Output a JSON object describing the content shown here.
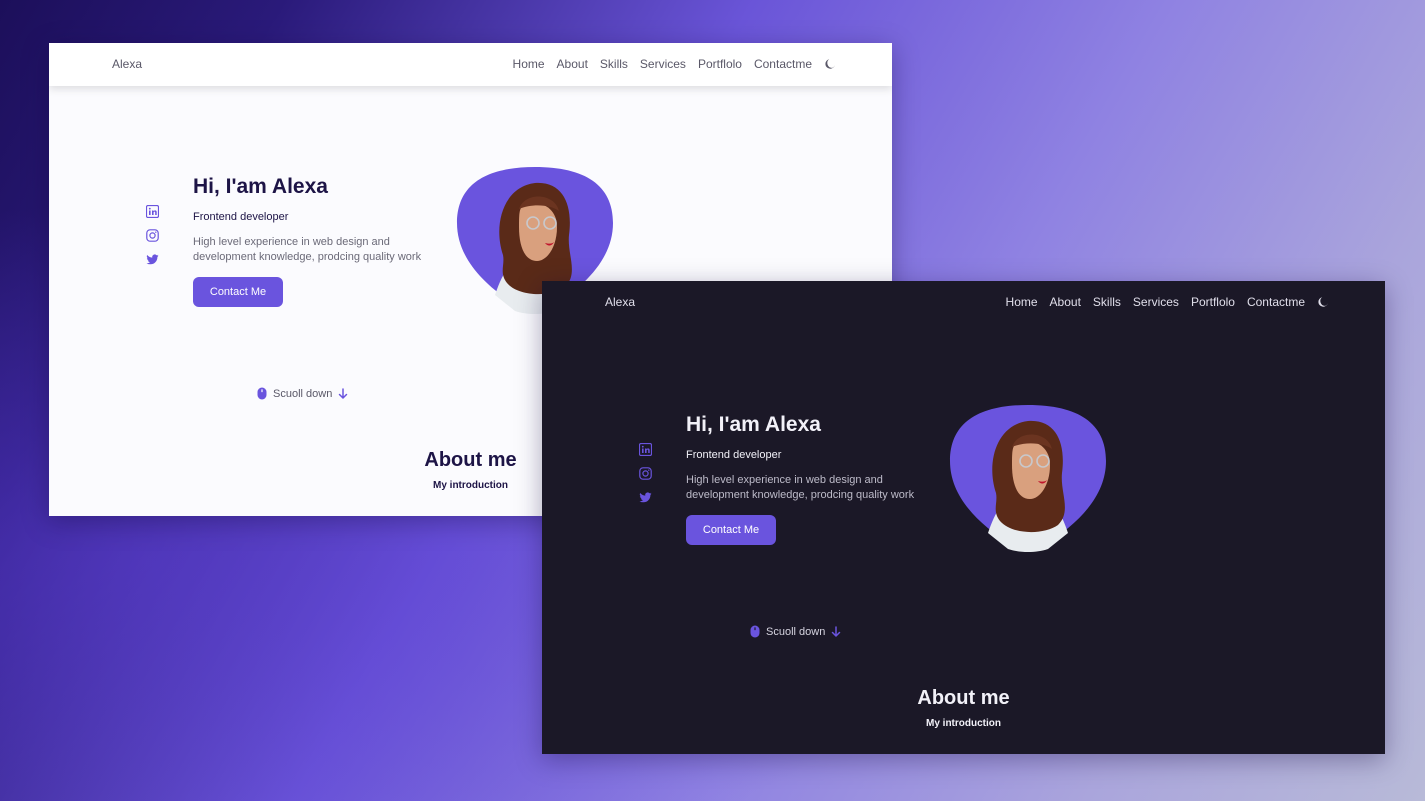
{
  "colors": {
    "accent": "#6a54de",
    "light_bg": "#fbfbfe",
    "dark_bg": "#1b1827",
    "title_dark": "#1d1446"
  },
  "light": {
    "brand": "Alexa",
    "nav": [
      "Home",
      "About",
      "Skills",
      "Services",
      "Portflolo",
      "Contactme"
    ],
    "hero": {
      "title": "Hi, I'am Alexa",
      "subtitle": "Frontend developer",
      "description": "High level experience in web design and development knowledge, prodcing quality work",
      "button": "Contact Me"
    },
    "scroll": "Scuoll down",
    "about": {
      "title": "About me",
      "subtitle": "My introduction"
    },
    "icons": [
      "linkedin-icon",
      "instagram-icon",
      "twitter-icon",
      "moon-icon",
      "mouse-icon",
      "arrow-down-icon"
    ]
  },
  "dark": {
    "brand": "Alexa",
    "nav": [
      "Home",
      "About",
      "Skills",
      "Services",
      "Portflolo",
      "Contactme"
    ],
    "hero": {
      "title": "Hi, I'am Alexa",
      "subtitle": "Frontend developer",
      "description": "High level experience in web design and development knowledge, prodcing quality work",
      "button": "Contact Me"
    },
    "scroll": "Scuoll down",
    "about": {
      "title": "About me",
      "subtitle": "My introduction"
    },
    "icons": [
      "linkedin-icon",
      "instagram-icon",
      "twitter-icon",
      "moon-icon",
      "mouse-icon",
      "arrow-down-icon"
    ]
  }
}
